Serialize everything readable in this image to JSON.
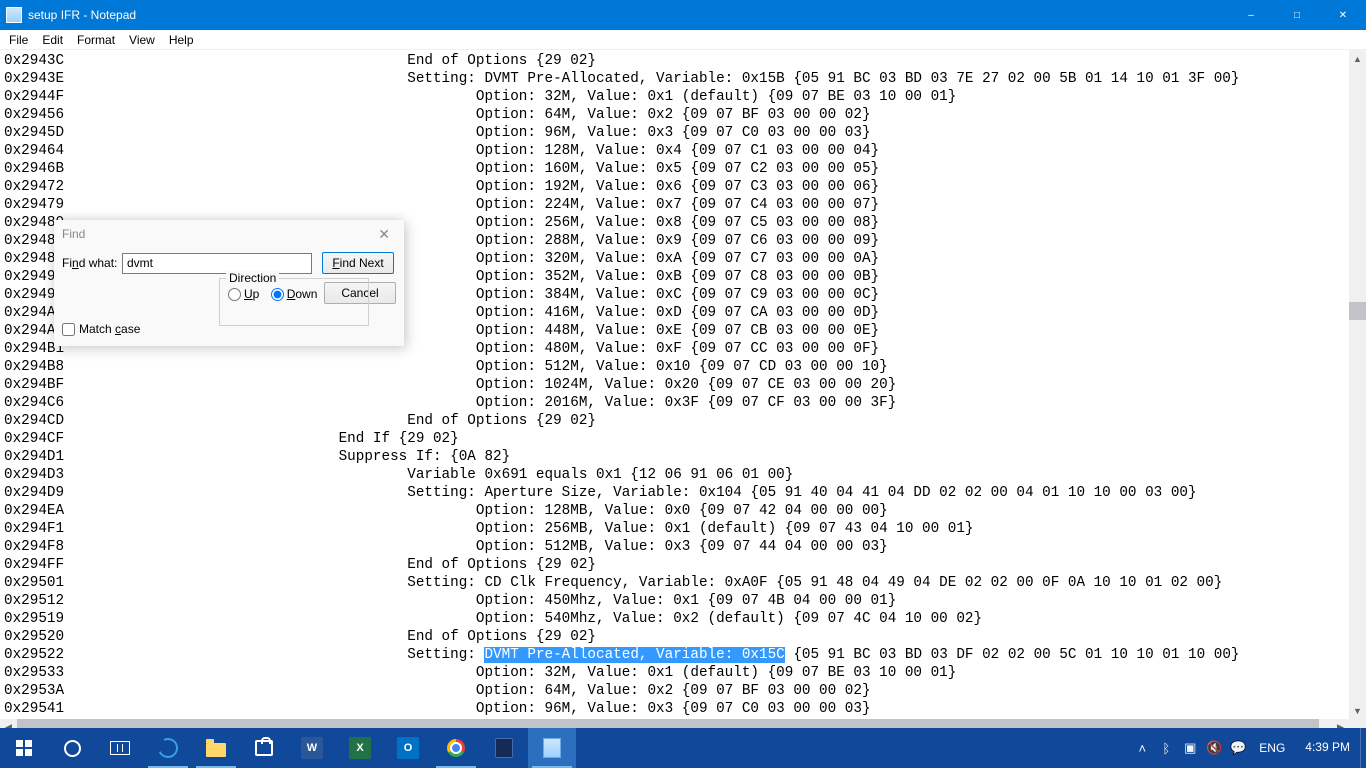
{
  "window": {
    "title": "setup IFR - Notepad",
    "min_tip": "Minimize",
    "max_tip": "Maximize",
    "close_tip": "Close"
  },
  "menu": {
    "file": "File",
    "edit": "Edit",
    "format": "Format",
    "view": "View",
    "help": "Help"
  },
  "find": {
    "title": "Find",
    "find_what_label": "Find what:",
    "find_what_value": "dvmt",
    "find_next": "Find Next",
    "find_next_key": "F",
    "cancel": "Cancel",
    "direction_label": "Direction",
    "up_label": "Up",
    "up_key": "U",
    "down_label": "Down",
    "down_key": "D",
    "match_case_label": "Match case",
    "match_case_key": "c",
    "direction_value": "Down"
  },
  "text_lines": [
    {
      "addr": "0x2943C",
      "indent": 5,
      "text": "End of Options {29 02}"
    },
    {
      "addr": "0x2943E",
      "indent": 5,
      "text": "Setting: DVMT Pre-Allocated, Variable: 0x15B {05 91 BC 03 BD 03 7E 27 02 00 5B 01 14 10 01 3F 00}"
    },
    {
      "addr": "0x2944F",
      "indent": 6,
      "text": "Option: 32M, Value: 0x1 (default) {09 07 BE 03 10 00 01}"
    },
    {
      "addr": "0x29456",
      "indent": 6,
      "text": "Option: 64M, Value: 0x2 {09 07 BF 03 00 00 02}"
    },
    {
      "addr": "0x2945D",
      "indent": 6,
      "text": "Option: 96M, Value: 0x3 {09 07 C0 03 00 00 03}"
    },
    {
      "addr": "0x29464",
      "indent": 6,
      "text": "Option: 128M, Value: 0x4 {09 07 C1 03 00 00 04}"
    },
    {
      "addr": "0x2946B",
      "indent": 6,
      "text": "Option: 160M, Value: 0x5 {09 07 C2 03 00 00 05}"
    },
    {
      "addr": "0x29472",
      "indent": 6,
      "text": "Option: 192M, Value: 0x6 {09 07 C3 03 00 00 06}"
    },
    {
      "addr": "0x29479",
      "indent": 6,
      "text": "Option: 224M, Value: 0x7 {09 07 C4 03 00 00 07}"
    },
    {
      "addr": "0x29480",
      "indent": 6,
      "text": "Option: 256M, Value: 0x8 {09 07 C5 03 00 00 08}"
    },
    {
      "addr": "0x29487",
      "indent": 6,
      "text": "Option: 288M, Value: 0x9 {09 07 C6 03 00 00 09}"
    },
    {
      "addr": "0x2948E",
      "indent": 6,
      "text": "Option: 320M, Value: 0xA {09 07 C7 03 00 00 0A}"
    },
    {
      "addr": "0x29495",
      "indent": 6,
      "text": "Option: 352M, Value: 0xB {09 07 C8 03 00 00 0B}"
    },
    {
      "addr": "0x2949C",
      "indent": 6,
      "text": "Option: 384M, Value: 0xC {09 07 C9 03 00 00 0C}"
    },
    {
      "addr": "0x294A3",
      "indent": 6,
      "text": "Option: 416M, Value: 0xD {09 07 CA 03 00 00 0D}"
    },
    {
      "addr": "0x294AA",
      "indent": 6,
      "text": "Option: 448M, Value: 0xE {09 07 CB 03 00 00 0E}"
    },
    {
      "addr": "0x294B1",
      "indent": 6,
      "text": "Option: 480M, Value: 0xF {09 07 CC 03 00 00 0F}"
    },
    {
      "addr": "0x294B8",
      "indent": 6,
      "text": "Option: 512M, Value: 0x10 {09 07 CD 03 00 00 10}"
    },
    {
      "addr": "0x294BF",
      "indent": 6,
      "text": "Option: 1024M, Value: 0x20 {09 07 CE 03 00 00 20}"
    },
    {
      "addr": "0x294C6",
      "indent": 6,
      "text": "Option: 2016M, Value: 0x3F {09 07 CF 03 00 00 3F}"
    },
    {
      "addr": "0x294CD",
      "indent": 5,
      "text": "End of Options {29 02}"
    },
    {
      "addr": "0x294CF",
      "indent": 4,
      "text": "End If {29 02}"
    },
    {
      "addr": "0x294D1",
      "indent": 4,
      "text": "Suppress If: {0A 82}"
    },
    {
      "addr": "0x294D3",
      "indent": 5,
      "text": "Variable 0x691 equals 0x1 {12 06 91 06 01 00}"
    },
    {
      "addr": "0x294D9",
      "indent": 5,
      "text": "Setting: Aperture Size, Variable: 0x104 {05 91 40 04 41 04 DD 02 02 00 04 01 10 10 00 03 00}"
    },
    {
      "addr": "0x294EA",
      "indent": 6,
      "text": "Option: 128MB, Value: 0x0 {09 07 42 04 00 00 00}"
    },
    {
      "addr": "0x294F1",
      "indent": 6,
      "text": "Option: 256MB, Value: 0x1 (default) {09 07 43 04 10 00 01}"
    },
    {
      "addr": "0x294F8",
      "indent": 6,
      "text": "Option: 512MB, Value: 0x3 {09 07 44 04 00 00 03}"
    },
    {
      "addr": "0x294FF",
      "indent": 5,
      "text": "End of Options {29 02}"
    },
    {
      "addr": "0x29501",
      "indent": 5,
      "text": "Setting: CD Clk Frequency, Variable: 0xA0F {05 91 48 04 49 04 DE 02 02 00 0F 0A 10 10 01 02 00}"
    },
    {
      "addr": "0x29512",
      "indent": 6,
      "text": "Option: 450Mhz, Value: 0x1 {09 07 4B 04 00 00 01}"
    },
    {
      "addr": "0x29519",
      "indent": 6,
      "text": "Option: 540Mhz, Value: 0x2 (default) {09 07 4C 04 10 00 02}"
    },
    {
      "addr": "0x29520",
      "indent": 5,
      "text": "End of Options {29 02}"
    },
    {
      "addr": "0x29522",
      "indent": 5,
      "text": "Setting: ",
      "hl": "DVMT Pre-Allocated, Variable: 0x15C",
      "tail": " {05 91 BC 03 BD 03 DF 02 02 00 5C 01 10 10 01 10 00}"
    },
    {
      "addr": "0x29533",
      "indent": 6,
      "text": "Option: 32M, Value: 0x1 (default) {09 07 BE 03 10 00 01}"
    },
    {
      "addr": "0x2953A",
      "indent": 6,
      "text": "Option: 64M, Value: 0x2 {09 07 BF 03 00 00 02}"
    },
    {
      "addr": "0x29541",
      "indent": 6,
      "text": "Option: 96M, Value: 0x3 {09 07 C0 03 00 00 03}"
    }
  ],
  "tray": {
    "lang": "ENG",
    "time": "4:39 PM"
  }
}
